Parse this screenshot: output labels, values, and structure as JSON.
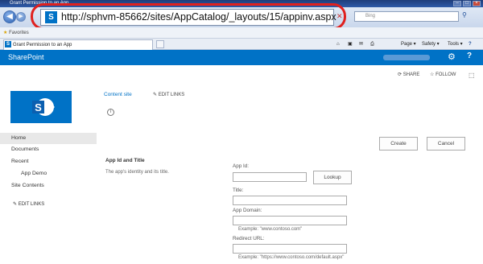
{
  "window": {
    "title": "Grant Permission to an App"
  },
  "browser": {
    "url": "http://sphvm-85662/sites/AppCatalog/_layouts/15/appinv.aspx",
    "search_placeholder": "Bing",
    "favorites_label": "Favorites",
    "tab_title": "Grant Permission to an App",
    "tools": {
      "page": "Page ▾",
      "safety": "Safety ▾",
      "tools": "Tools ▾"
    }
  },
  "suite": {
    "brand": "SharePoint"
  },
  "actions": {
    "share": "SHARE",
    "follow": "FOLLOW"
  },
  "header": {
    "content_site": "Content site",
    "edit_links": "EDIT LINKS"
  },
  "nav": {
    "items": [
      "Home",
      "Documents",
      "Recent",
      "App Demo",
      "Site Contents"
    ],
    "edit_links": "EDIT LINKS"
  },
  "buttons": {
    "create": "Create",
    "cancel": "Cancel",
    "lookup": "Lookup"
  },
  "section": {
    "title": "App Id and Title",
    "description": "The app's identity and its title."
  },
  "form": {
    "app_id_label": "App Id:",
    "app_id_value": "",
    "title_label": "Title:",
    "title_value": "",
    "app_domain_label": "App Domain:",
    "app_domain_value": "",
    "app_domain_example": "Example: \"www.contoso.com\"",
    "redirect_label": "Redirect URL:",
    "redirect_value": "",
    "redirect_example": "Example: \"https://www.contoso.com/default.aspx\""
  },
  "colors": {
    "accent": "#0072c6",
    "highlight": "#e0201e"
  }
}
